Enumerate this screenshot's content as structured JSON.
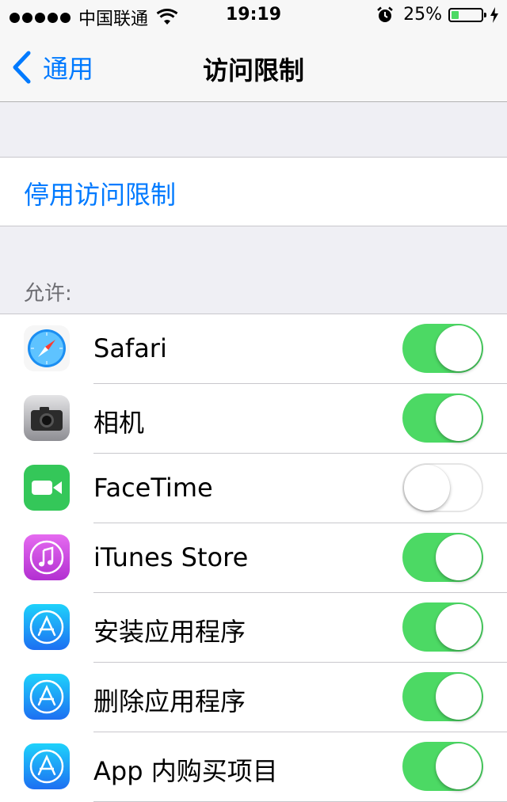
{
  "status_bar": {
    "carrier": "中国联通",
    "time": "19:19",
    "battery_percent": "25%",
    "battery_level": 0.25
  },
  "nav": {
    "back_label": "通用",
    "title": "访问限制"
  },
  "disable_restrictions_label": "停用访问限制",
  "allow_header": "允许:",
  "apps": [
    {
      "label": "Safari",
      "enabled": true,
      "icon": "safari-icon"
    },
    {
      "label": "相机",
      "enabled": true,
      "icon": "camera-icon"
    },
    {
      "label": "FaceTime",
      "enabled": false,
      "icon": "facetime-icon"
    },
    {
      "label": "iTunes Store",
      "enabled": true,
      "icon": "itunes-store-icon"
    },
    {
      "label": "安装应用程序",
      "enabled": true,
      "icon": "app-store-icon"
    },
    {
      "label": "删除应用程序",
      "enabled": true,
      "icon": "app-store-icon"
    },
    {
      "label": "App 内购买项目",
      "enabled": true,
      "icon": "app-store-icon"
    }
  ],
  "colors": {
    "accent": "#007aff",
    "toggle_on": "#4cd964"
  }
}
